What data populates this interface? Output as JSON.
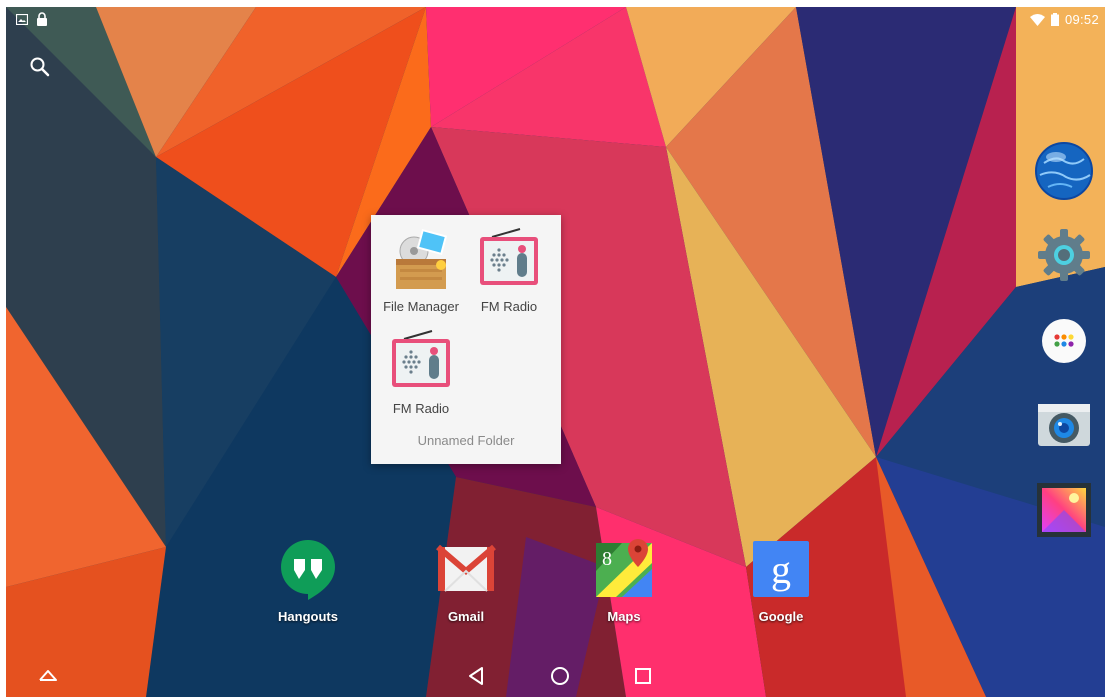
{
  "status_bar": {
    "time": "09:52",
    "left_icons": [
      "gallery-notification-icon",
      "lock-icon"
    ],
    "right_icons": [
      "wifi-icon",
      "battery-icon"
    ]
  },
  "search": {
    "icon": "search-icon"
  },
  "folder": {
    "name": "Unnamed Folder",
    "apps": [
      {
        "label": "File Manager",
        "icon": "file-manager-icon"
      },
      {
        "label": "FM Radio",
        "icon": "fm-radio-icon"
      },
      {
        "label": "FM Radio",
        "icon": "fm-radio-icon"
      }
    ]
  },
  "dock": [
    {
      "label": "Hangouts",
      "icon": "hangouts-icon",
      "color": "#0f9d58"
    },
    {
      "label": "Gmail",
      "icon": "gmail-icon",
      "color": "#db4437"
    },
    {
      "label": "Maps",
      "icon": "maps-icon",
      "color": "#4caf50"
    },
    {
      "label": "Google",
      "icon": "google-search-icon",
      "color": "#4285f4"
    }
  ],
  "right_rail": [
    {
      "icon": "browser-globe-icon"
    },
    {
      "icon": "settings-gear-icon"
    },
    {
      "icon": "all-apps-icon"
    },
    {
      "icon": "camera-icon"
    },
    {
      "icon": "gallery-icon"
    }
  ],
  "nav_bar": [
    "up-arrow-icon",
    "back-icon",
    "home-icon",
    "recents-icon"
  ]
}
